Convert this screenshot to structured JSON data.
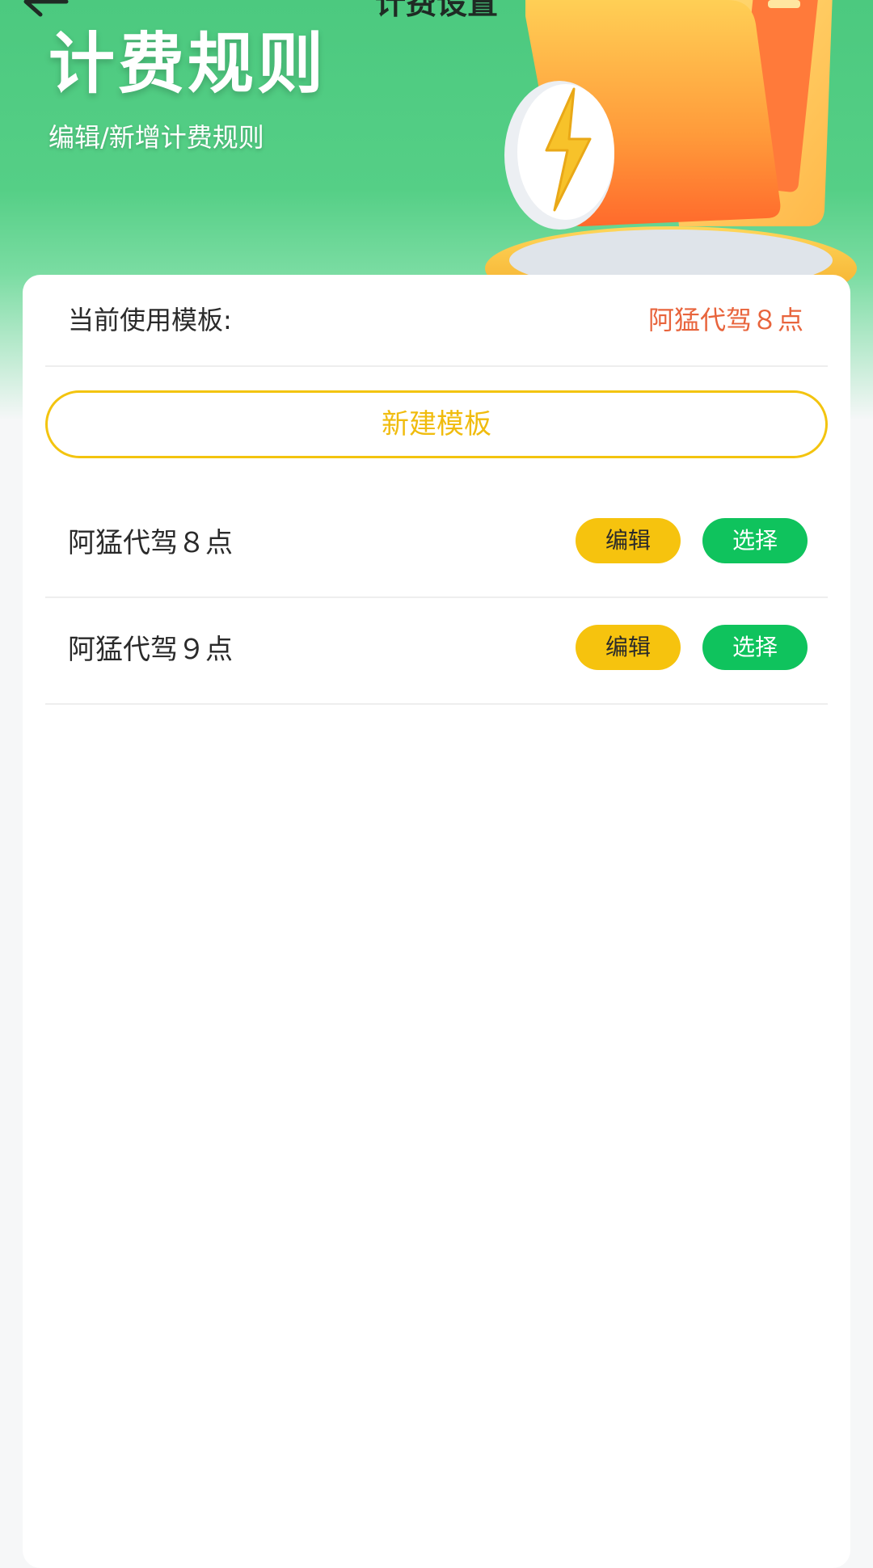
{
  "nav": {
    "title": "计费设置",
    "back_icon": "arrow-left-icon"
  },
  "hero": {
    "title": "计费规则",
    "subtitle": "编辑/新增计费规则",
    "illustration_icon": "folder-lightning-illustration"
  },
  "current": {
    "label": "当前使用模板:",
    "value": "阿猛代驾８点"
  },
  "new_template_label": "新建模板",
  "templates": [
    {
      "name": "阿猛代驾８点",
      "edit_label": "编辑",
      "select_label": "选择"
    },
    {
      "name": "阿猛代驾９点",
      "edit_label": "编辑",
      "select_label": "选择"
    }
  ],
  "colors": {
    "brand_green": "#4cc97f",
    "accent_yellow": "#f6c30e",
    "select_green": "#0fc35d",
    "current_value_orange": "#e8643c"
  }
}
